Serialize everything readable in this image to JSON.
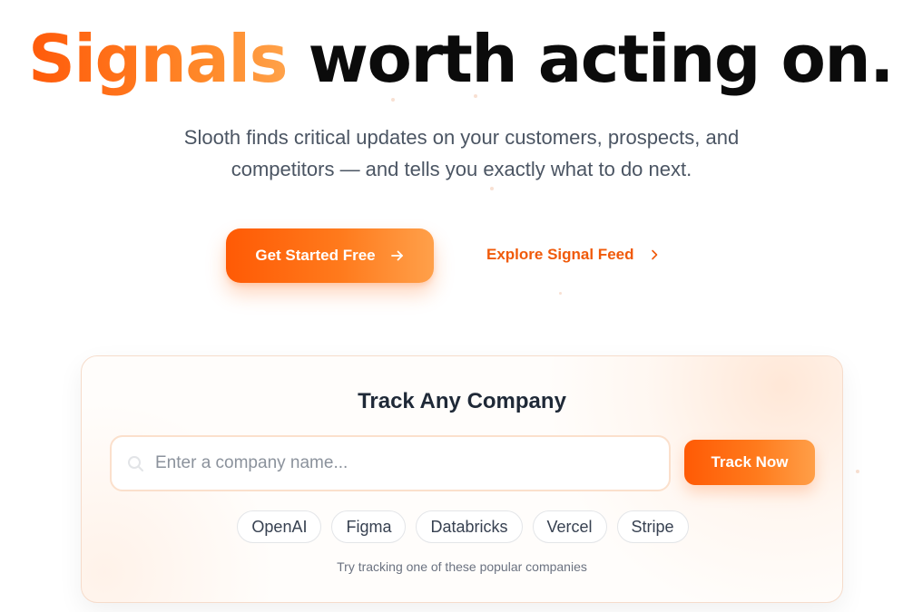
{
  "hero": {
    "title_accent": "Signals",
    "title_rest": " worth acting on.",
    "subtitle": "Slooth finds critical updates on your customers, prospects, and competitors — and tells you exactly what to do next."
  },
  "cta": {
    "primary_label": "Get Started Free",
    "primary_icon": "arrow-right-icon",
    "secondary_label": "Explore Signal Feed",
    "secondary_icon": "chevron-right-icon"
  },
  "tracker": {
    "title": "Track Any Company",
    "search_placeholder": "Enter a company name...",
    "search_value": "",
    "search_icon": "search-icon",
    "button_label": "Track Now",
    "suggestions": [
      "OpenAI",
      "Figma",
      "Databricks",
      "Vercel",
      "Stripe"
    ],
    "hint": "Try tracking one of these popular companies"
  },
  "colors": {
    "accent": "#ff5a05",
    "accent_light": "#ffa04a",
    "link": "#f05a0a",
    "heading": "#0b0b0b",
    "body_text": "#4b5563"
  }
}
